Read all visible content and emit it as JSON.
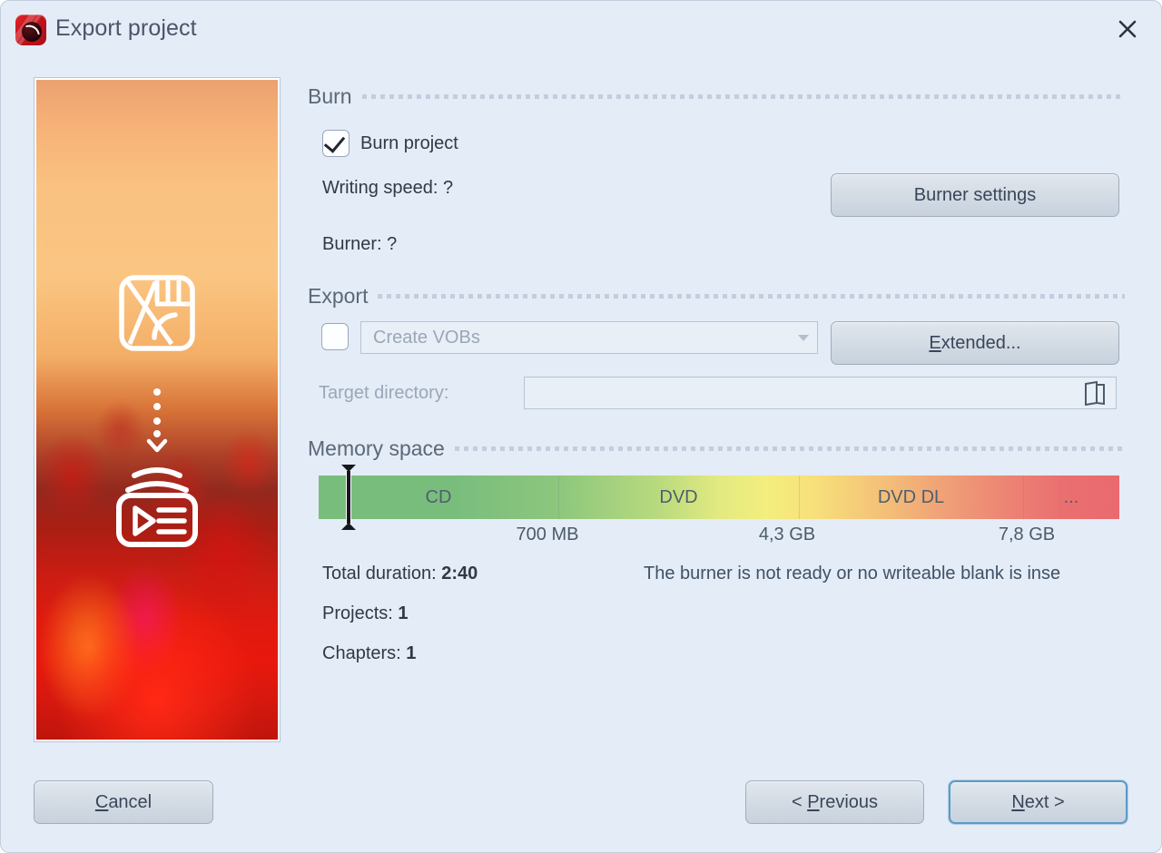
{
  "window": {
    "title": "Export project",
    "app_icon": "disc-burner-icon",
    "close_icon": "close-icon"
  },
  "preview": {
    "name": "project-preview",
    "description": "blurred poppy field at sunset with overlay icons",
    "overlay_icons": [
      "film-editor-icon",
      "arrow-down-dotted-icon",
      "disc-stack-play-icon"
    ]
  },
  "sections": {
    "burn": {
      "title": "Burn",
      "checkbox": {
        "label": "Burn project",
        "checked": true
      },
      "writing_speed_label": "Writing speed: ?",
      "burner_label": "Burner: ?",
      "settings_button": "Burner settings"
    },
    "export": {
      "title": "Export",
      "checkbox": {
        "checked": false
      },
      "format_value": "Create VOBs",
      "format_options": [
        "Create VOBs"
      ],
      "extended_button": {
        "prefix": "E",
        "suffix": "xtended..."
      },
      "target_directory_label": "Target directory:",
      "target_directory_value": "",
      "browse_icon": "open-folder-icon"
    },
    "memory": {
      "title": "Memory space",
      "segments": [
        {
          "label": "CD",
          "start_pct": 0,
          "end_pct": 30
        },
        {
          "label": "DVD",
          "start_pct": 30,
          "end_pct": 60
        },
        {
          "label": "DVD DL",
          "start_pct": 60,
          "end_pct": 88
        },
        {
          "label": "...",
          "start_pct": 88,
          "end_pct": 100
        }
      ],
      "ticks": [
        {
          "label": "700 MB",
          "pct": 30
        },
        {
          "label": "4,3 GB",
          "pct": 60
        },
        {
          "label": "7,8 GB",
          "pct": 90
        }
      ],
      "usage_marker_pct": 5.2
    }
  },
  "stats": {
    "total_duration_label": "Total duration:",
    "total_duration_value": "2:40",
    "projects_label": "Projects:",
    "projects_value": "1",
    "chapters_label": "Chapters:",
    "chapters_value": "1"
  },
  "status": {
    "burner_warning": "The burner is not ready or no writeable blank is inse"
  },
  "footer": {
    "cancel": {
      "prefix": "C",
      "suffix": "ancel"
    },
    "previous": {
      "lead": "< ",
      "prefix": "P",
      "suffix": "revious"
    },
    "next": {
      "prefix": "N",
      "suffix": "ext >"
    }
  },
  "colors": {
    "dialog_bg": "#e4ecf7",
    "accent_focus": "#5b9bc4",
    "bar_green": "#79bd7d",
    "bar_yellow": "#f4ee7e",
    "bar_red": "#e96a6f"
  }
}
